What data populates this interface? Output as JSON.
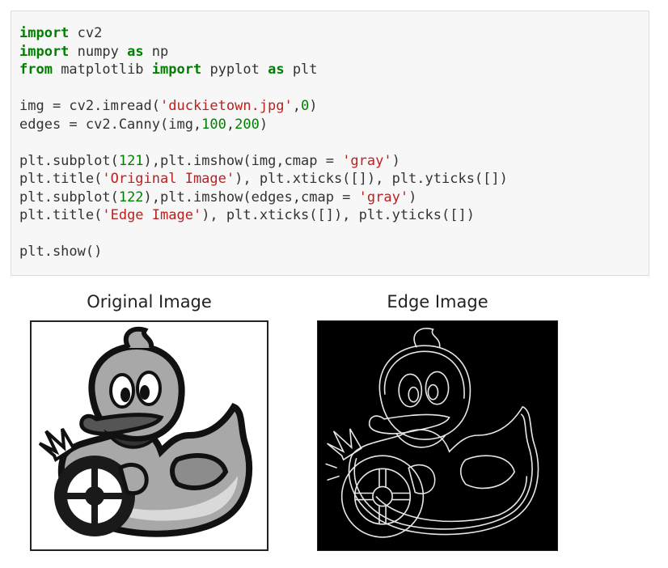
{
  "code_cell": {
    "lines": [
      [
        {
          "t": "import",
          "c": "kw"
        },
        {
          "t": " cv2",
          "c": ""
        }
      ],
      [
        {
          "t": "import",
          "c": "kw"
        },
        {
          "t": " numpy ",
          "c": ""
        },
        {
          "t": "as",
          "c": "kw"
        },
        {
          "t": " np",
          "c": ""
        }
      ],
      [
        {
          "t": "from",
          "c": "kw"
        },
        {
          "t": " matplotlib ",
          "c": ""
        },
        {
          "t": "import",
          "c": "kw"
        },
        {
          "t": " pyplot ",
          "c": ""
        },
        {
          "t": "as",
          "c": "kw"
        },
        {
          "t": " plt",
          "c": ""
        }
      ],
      [],
      [
        {
          "t": "img = cv2.imread(",
          "c": ""
        },
        {
          "t": "'duckietown.jpg'",
          "c": "str"
        },
        {
          "t": ",",
          "c": ""
        },
        {
          "t": "0",
          "c": "num"
        },
        {
          "t": ")",
          "c": ""
        }
      ],
      [
        {
          "t": "edges = cv2.Canny(img,",
          "c": ""
        },
        {
          "t": "100",
          "c": "num"
        },
        {
          "t": ",",
          "c": ""
        },
        {
          "t": "200",
          "c": "num"
        },
        {
          "t": ")",
          "c": ""
        }
      ],
      [],
      [
        {
          "t": "plt.subplot(",
          "c": ""
        },
        {
          "t": "121",
          "c": "num"
        },
        {
          "t": "),plt.imshow(img,cmap = ",
          "c": ""
        },
        {
          "t": "'gray'",
          "c": "str"
        },
        {
          "t": ")",
          "c": ""
        }
      ],
      [
        {
          "t": "plt.title(",
          "c": ""
        },
        {
          "t": "'Original Image'",
          "c": "str"
        },
        {
          "t": "), plt.xticks([]), plt.yticks([])",
          "c": ""
        }
      ],
      [
        {
          "t": "plt.subplot(",
          "c": ""
        },
        {
          "t": "122",
          "c": "num"
        },
        {
          "t": "),plt.imshow(edges,cmap = ",
          "c": ""
        },
        {
          "t": "'gray'",
          "c": "str"
        },
        {
          "t": ")",
          "c": ""
        }
      ],
      [
        {
          "t": "plt.title(",
          "c": ""
        },
        {
          "t": "'Edge Image'",
          "c": "str"
        },
        {
          "t": "), plt.xticks([]), plt.yticks([])",
          "c": ""
        }
      ],
      [],
      [
        {
          "t": "plt.show()",
          "c": ""
        }
      ]
    ]
  },
  "output": {
    "original_title": "Original Image",
    "edge_title": "Edge Image"
  },
  "colors": {
    "keyword": "#008000",
    "string": "#ba2121",
    "number": "#008000",
    "code_background": "#f7f7f7"
  }
}
